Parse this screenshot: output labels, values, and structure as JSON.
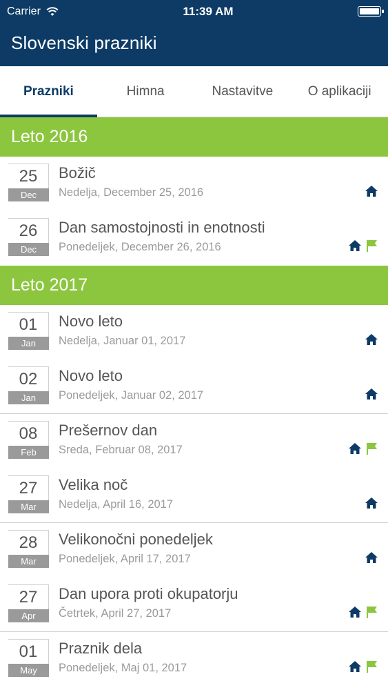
{
  "status_bar": {
    "carrier": "Carrier",
    "time": "11:39 AM"
  },
  "app": {
    "title": "Slovenski prazniki"
  },
  "tabs": [
    {
      "label": "Prazniki",
      "active": true
    },
    {
      "label": "Himna",
      "active": false
    },
    {
      "label": "Nastavitve",
      "active": false
    },
    {
      "label": "O aplikaciji",
      "active": false
    }
  ],
  "colors": {
    "primary": "#0d3b66",
    "accent": "#8cc63f",
    "month_badge": "#9a9a9a"
  },
  "sections": [
    {
      "title": "Leto 2016",
      "items": [
        {
          "day": "25",
          "month": "Dec",
          "name": "Božič",
          "subtitle": "Nedelja, December 25, 2016",
          "icons": [
            "home-icon"
          ]
        },
        {
          "day": "26",
          "month": "Dec",
          "name": "Dan samostojnosti in enotnosti",
          "subtitle": "Ponedeljek, December 26, 2016",
          "icons": [
            "home-icon",
            "flag-icon"
          ]
        }
      ]
    },
    {
      "title": "Leto 2017",
      "items": [
        {
          "day": "01",
          "month": "Jan",
          "name": "Novo leto",
          "subtitle": "Nedelja, Januar 01, 2017",
          "icons": [
            "home-icon"
          ]
        },
        {
          "day": "02",
          "month": "Jan",
          "name": "Novo leto",
          "subtitle": "Ponedeljek, Januar 02, 2017",
          "icons": [
            "home-icon"
          ]
        },
        {
          "day": "08",
          "month": "Feb",
          "name": "Prešernov dan",
          "subtitle": "Sreda, Februar 08, 2017",
          "icons": [
            "home-icon",
            "flag-icon"
          ]
        },
        {
          "day": "27",
          "month": "Mar",
          "name": "Velika noč",
          "subtitle": "Nedelja, April 16, 2017",
          "icons": [
            "home-icon"
          ]
        },
        {
          "day": "28",
          "month": "Mar",
          "name": "Velikonočni ponedeljek",
          "subtitle": "Ponedeljek, April 17, 2017",
          "icons": [
            "home-icon"
          ]
        },
        {
          "day": "27",
          "month": "Apr",
          "name": "Dan upora proti okupatorju",
          "subtitle": "Četrtek, April 27, 2017",
          "icons": [
            "home-icon",
            "flag-icon"
          ]
        },
        {
          "day": "01",
          "month": "May",
          "name": "Praznik dela",
          "subtitle": "Ponedeljek, Maj 01, 2017",
          "icons": [
            "home-icon",
            "flag-icon"
          ]
        }
      ]
    }
  ]
}
